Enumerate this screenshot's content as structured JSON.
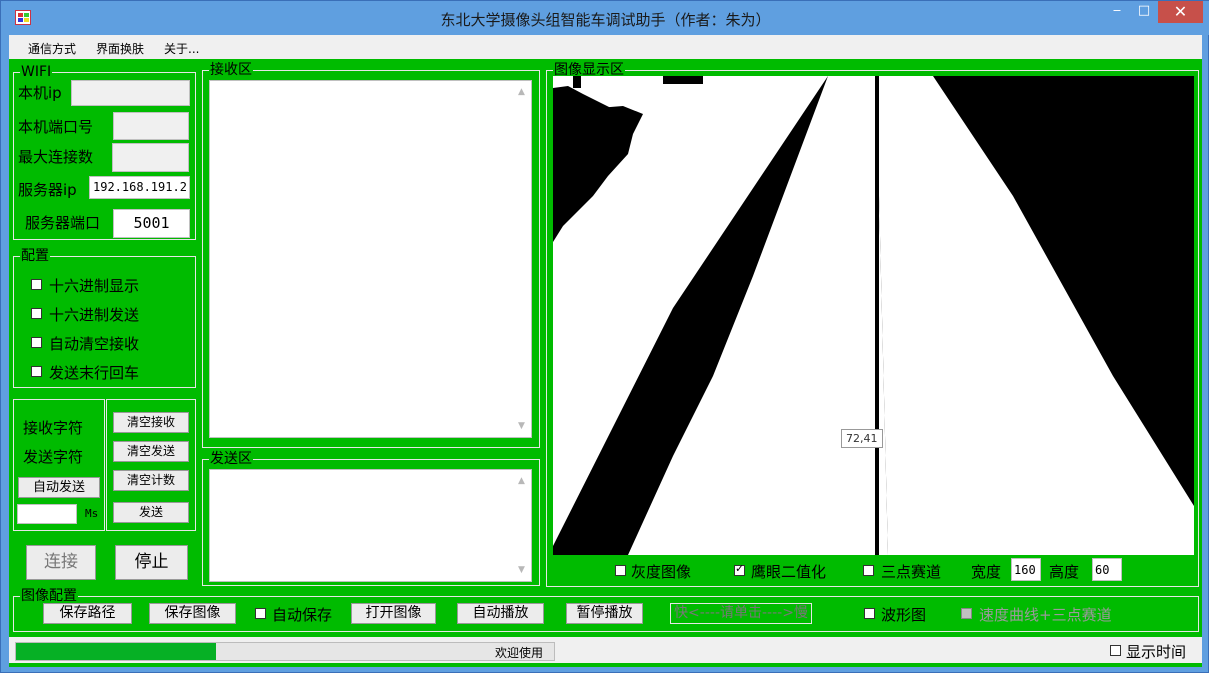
{
  "window": {
    "title": "东北大学摄像头组智能车调试助手（作者：朱为）",
    "min_glyph": "‒",
    "max_glyph": "□",
    "close_glyph": "✕"
  },
  "menu": [
    "通信方式",
    "界面换肤",
    "关于..."
  ],
  "wifi": {
    "title": "WIFI",
    "local_ip_label": "本机ip",
    "local_ip_value": "",
    "local_port_label": "本机端口号",
    "local_port_value": "",
    "max_conn_label": "最大连接数",
    "max_conn_value": "",
    "server_ip_label": "服务器ip",
    "server_ip_value": "192.168.191.2",
    "server_port_label": "服务器端口",
    "server_port_value": "5001"
  },
  "config": {
    "title": "配置",
    "options": [
      {
        "label": "十六进制显示",
        "checked": false
      },
      {
        "label": "十六进制发送",
        "checked": false
      },
      {
        "label": "自动清空接收",
        "checked": false
      },
      {
        "label": "发送末行回车",
        "checked": false
      }
    ]
  },
  "counters": {
    "recv_label": "接收字符",
    "send_label": "发送字符",
    "auto_send_button": "自动发送",
    "interval_value": "",
    "interval_unit": "Ms",
    "clear_recv_button": "清空接收",
    "clear_send_button": "清空发送",
    "clear_count_button": "清空计数",
    "send_button": "发送"
  },
  "connect_button": "连接",
  "stop_button": "停止",
  "receive_area": {
    "title": "接收区",
    "content": ""
  },
  "send_area": {
    "title": "发送区",
    "content": ""
  },
  "image_display": {
    "title": "图像显示区",
    "cursor_tooltip": "72,41",
    "gray_label": "灰度图像",
    "gray_checked": false,
    "eagle_label": "鹰眼二值化",
    "eagle_checked": true,
    "three_point_label": "三点赛道",
    "three_point_checked": false,
    "width_label": "宽度",
    "width_value": "160",
    "height_label": "高度",
    "height_value": "60"
  },
  "image_config": {
    "title": "图像配置",
    "save_path_button": "保存路径",
    "save_image_button": "保存图像",
    "auto_save_label": "自动保存",
    "auto_save_checked": false,
    "open_image_button": "打开图像",
    "auto_play_button": "自动播放",
    "pause_play_button": "暂停播放",
    "speed_label": "快<----请单击---->慢",
    "waveform_label": "波形图",
    "waveform_checked": false,
    "speed_curve_label": "速度曲线+三点赛道",
    "speed_curve_checked": false
  },
  "status": {
    "progress_fraction": 0.37,
    "text": "欢迎使用",
    "show_time_label": "显示时间",
    "show_time_checked": false
  },
  "colors": {
    "client_bg": "#00bb00",
    "titlebar": "#5f9fe0",
    "close": "#c7504a",
    "progress": "#06b025"
  }
}
